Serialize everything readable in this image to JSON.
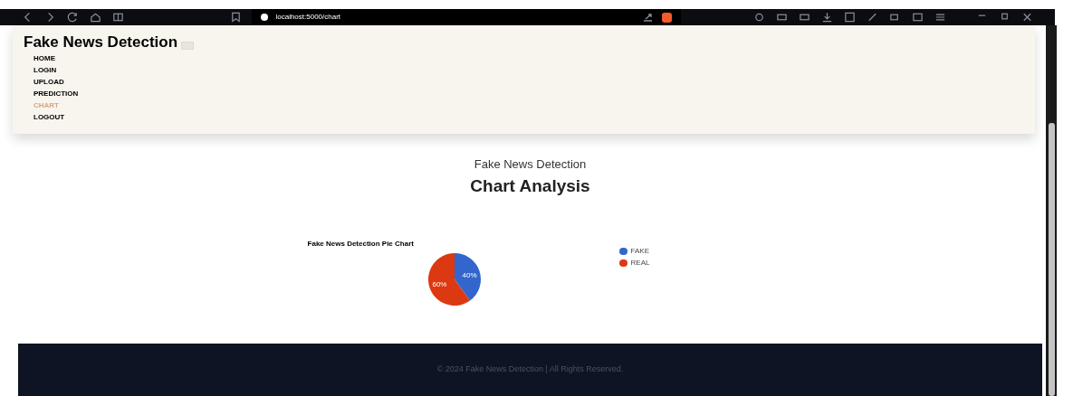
{
  "browser": {
    "url": "localhost:5000/chart"
  },
  "header": {
    "title": "Fake News Detection",
    "nav": [
      {
        "label": "HOME",
        "selected": false
      },
      {
        "label": "LOGIN",
        "selected": false
      },
      {
        "label": "UPLOAD",
        "selected": false
      },
      {
        "label": "PREDICTION",
        "selected": false
      },
      {
        "label": "CHART",
        "selected": true
      },
      {
        "label": "LOGOUT",
        "selected": false
      }
    ]
  },
  "main": {
    "subtitle": "Fake News Detection",
    "title": "Chart Analysis",
    "chart_data": {
      "type": "pie",
      "title": "Fake News Detection Pie Chart",
      "categories": [
        "FAKE",
        "REAL"
      ],
      "values": [
        40,
        60
      ],
      "legend": "right",
      "colors": [
        "#3366cc",
        "#dc3912"
      ],
      "value_labels": [
        "40%",
        "60%"
      ]
    }
  },
  "footer": {
    "text": "© 2024 Fake News Detection | All Rights Reserved."
  }
}
